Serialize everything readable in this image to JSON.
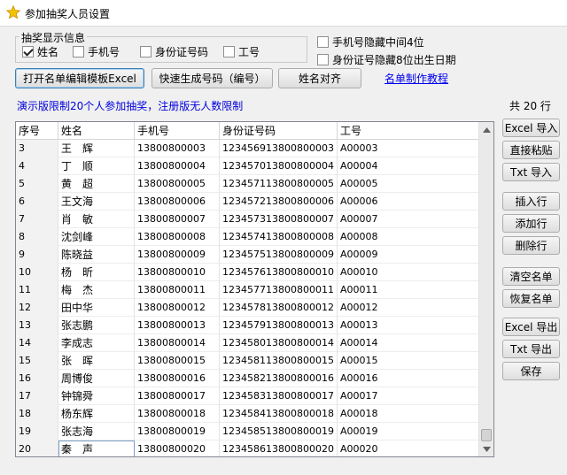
{
  "window": {
    "title": "参加抽奖人员设置"
  },
  "display_group": {
    "title": "抽奖显示信息",
    "name_label": "姓名",
    "name_checked": true,
    "phone_label": "手机号",
    "phone_checked": false,
    "id_label": "身份证号码",
    "id_checked": false,
    "work_label": "工号",
    "work_checked": false
  },
  "options": {
    "hide_phone_label": "手机号隐藏中间4位",
    "hide_phone_checked": false,
    "hide_id_label": "身份证号隐藏8位出生日期",
    "hide_id_checked": false
  },
  "toolbar": {
    "open_template": "打开名单编辑模板Excel",
    "gen_numbers": "快速生成号码（编号）",
    "align_names": "姓名对齐",
    "tutorial_link": "名单制作教程"
  },
  "notice": "演示版限制20个人参加抽奖，注册版无人数限制",
  "row_count": "共 20 行",
  "table": {
    "headers": [
      "序号",
      "姓名",
      "手机号",
      "身份证号码",
      "工号"
    ],
    "rows": [
      [
        "3",
        "王　辉",
        "13800800003",
        "123456913800800003",
        "A00003"
      ],
      [
        "4",
        "丁　顺",
        "13800800004",
        "123457013800800004",
        "A00004"
      ],
      [
        "5",
        "黄　超",
        "13800800005",
        "123457113800800005",
        "A00005"
      ],
      [
        "6",
        "王文海",
        "13800800006",
        "123457213800800006",
        "A00006"
      ],
      [
        "7",
        "肖　敏",
        "13800800007",
        "123457313800800007",
        "A00007"
      ],
      [
        "8",
        "沈剑峰",
        "13800800008",
        "123457413800800008",
        "A00008"
      ],
      [
        "9",
        "陈晓益",
        "13800800009",
        "123457513800800009",
        "A00009"
      ],
      [
        "10",
        "杨　昕",
        "13800800010",
        "123457613800800010",
        "A00010"
      ],
      [
        "11",
        "梅　杰",
        "13800800011",
        "123457713800800011",
        "A00011"
      ],
      [
        "12",
        "田中华",
        "13800800012",
        "123457813800800012",
        "A00012"
      ],
      [
        "13",
        "张志鹏",
        "13800800013",
        "123457913800800013",
        "A00013"
      ],
      [
        "14",
        "李成志",
        "13800800014",
        "123458013800800014",
        "A00014"
      ],
      [
        "15",
        "张　晖",
        "13800800015",
        "123458113800800015",
        "A00015"
      ],
      [
        "16",
        "周博俊",
        "13800800016",
        "123458213800800016",
        "A00016"
      ],
      [
        "17",
        "钟锦舜",
        "13800800017",
        "123458313800800017",
        "A00017"
      ],
      [
        "18",
        "杨东辉",
        "13800800018",
        "123458413800800018",
        "A00018"
      ],
      [
        "19",
        "张志海",
        "13800800019",
        "123458513800800019",
        "A00019"
      ],
      [
        "20",
        "秦　声",
        "13800800020",
        "123458613800800020",
        "A00020"
      ]
    ]
  },
  "side_buttons": {
    "excel_import": "Excel 导入",
    "paste": "直接粘贴",
    "txt_import": "Txt 导入",
    "insert_row": "插入行",
    "add_row": "添加行",
    "delete_row": "删除行",
    "clear_list": "清空名单",
    "restore_list": "恢复名单",
    "excel_export": "Excel 导出",
    "txt_export": "Txt 导出",
    "save": "保存"
  },
  "icons": {
    "title_icon": "star-icon",
    "scroll_up": "arrow-up-icon",
    "scroll_down": "arrow-down-icon"
  },
  "colors": {
    "link": "#0000ee",
    "notice": "#0000dd",
    "star": "#f5c400"
  }
}
